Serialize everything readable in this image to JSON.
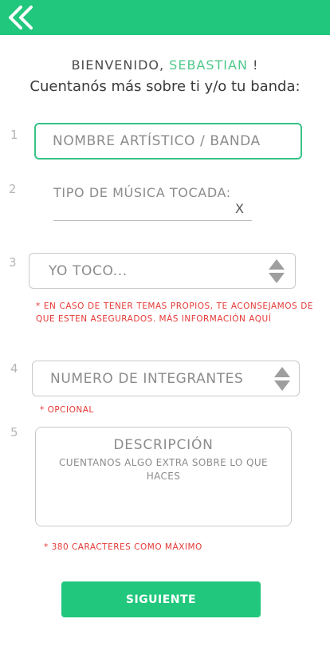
{
  "header": {
    "back_icon": "double-chevron-left-icon",
    "background": "#21c77c"
  },
  "welcome": {
    "greeting": "BIENVENIDO,",
    "name": "SEBASTIAN",
    "exclamation": "!",
    "subtitle": "Cuentanós más sobre ti y/o tu banda:"
  },
  "form": {
    "steps": [
      "1",
      "2",
      "3",
      "4",
      "5"
    ],
    "artist_name": {
      "placeholder": "NOMBRE ARTÍSTICO / BANDA"
    },
    "music_type": {
      "label": "TIPO DE MÚSICA TOCADA:",
      "clear": "X"
    },
    "instrument": {
      "value": "YO TOCO..."
    },
    "instrument_note": "* EN CASO DE TENER TEMAS PROPIOS, TE ACONSEJAMOS DE QUE ESTEN ASEGURADOS. MÁS INFORMACIÓN AQUÍ",
    "members": {
      "value": "NUMERO DE INTEGRANTES"
    },
    "members_note": "* OPCIONAL",
    "description": {
      "title": "DESCRIPCIÓN",
      "placeholder": "CUENTANOS ALGO EXTRA SOBRE LO QUE HACES"
    },
    "description_note": "* 380 CARACTERES COMO MÁXIMO",
    "submit_label": "SIGUIENTE"
  },
  "colors": {
    "accent": "#21c77c",
    "name_highlight": "#4fc98a",
    "warning": "#e53935"
  }
}
